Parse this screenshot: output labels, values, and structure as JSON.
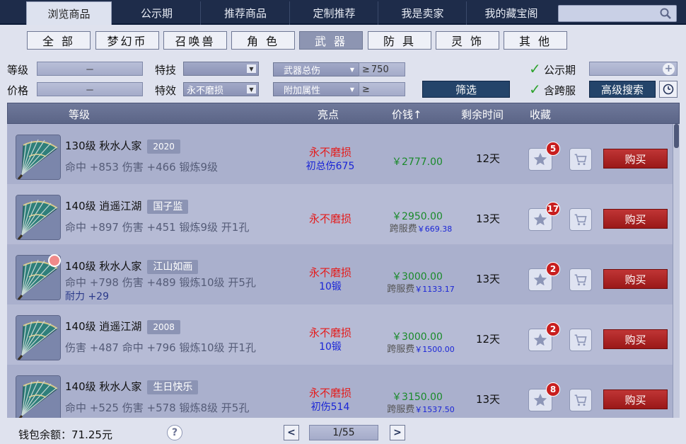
{
  "tabs": [
    {
      "label": "浏览商品",
      "active": true
    },
    {
      "label": "公示期",
      "active": false
    },
    {
      "label": "推荐商品",
      "active": false
    },
    {
      "label": "定制推荐",
      "active": false
    },
    {
      "label": "我是卖家",
      "active": false
    },
    {
      "label": "我的藏宝阁",
      "active": false
    }
  ],
  "search": {
    "value": ""
  },
  "categories": [
    {
      "label": "全 部",
      "active": false
    },
    {
      "label": "梦幻币",
      "active": false
    },
    {
      "label": "召唤兽",
      "active": false
    },
    {
      "label": "角 色",
      "active": false
    },
    {
      "label": "武 器",
      "active": true
    },
    {
      "label": "防 具",
      "active": false
    },
    {
      "label": "灵 饰",
      "active": false
    },
    {
      "label": "其 他",
      "active": false
    }
  ],
  "filters": {
    "level_label": "等级",
    "level_value": "－",
    "price_label": "价格",
    "price_value": "－",
    "skill_label": "特技",
    "skill_value": "",
    "effect_label": "特效",
    "effect_value": "永不磨损",
    "total_damage_select": "武器总伤",
    "total_damage_op": "≥",
    "total_damage_value": "750",
    "extra_attr_select": "附加属性",
    "extra_attr_op": "≥",
    "filter_button": "筛选",
    "public_period_label": "公示期",
    "public_period_checked": true,
    "cross_server_label": "含跨服",
    "cross_server_checked": true,
    "advanced_button": "高级搜索"
  },
  "table": {
    "headers": {
      "level": "等级",
      "highlights": "亮点",
      "price": "价钱",
      "price_sort": "↑",
      "remaining": "剩余时间",
      "favorite": "收藏"
    },
    "rows": [
      {
        "name": "130级  秋水人家",
        "tag": "2020",
        "stats": "命中 +853 伤害 +466 锻炼9级",
        "stats2": "",
        "highlight1": "永不磨损",
        "highlight2": "初总伤675",
        "price": "￥2777.00",
        "cross_fee_label": "",
        "cross_fee": "",
        "days": "12天",
        "fav_count": "5",
        "buy": "购买",
        "timer": false
      },
      {
        "name": "140级  逍遥江湖",
        "tag": "国子监",
        "stats": "命中 +897 伤害 +451 锻炼9级 开1孔",
        "stats2": "",
        "highlight1": "永不磨损",
        "highlight2": "",
        "price": "￥2950.00",
        "cross_fee_label": "跨服费",
        "cross_fee": "￥669.38",
        "days": "13天",
        "fav_count": "17",
        "buy": "购买",
        "timer": false
      },
      {
        "name": "140级  秋水人家",
        "tag": "江山如画",
        "stats": "命中 +798 伤害 +489 锻炼10级 开5孔",
        "stats2": "耐力 +29",
        "highlight1": "永不磨损",
        "highlight2": "10锻",
        "price": "￥3000.00",
        "cross_fee_label": "跨服费",
        "cross_fee": "￥1133.17",
        "days": "13天",
        "fav_count": "2",
        "buy": "购买",
        "timer": true
      },
      {
        "name": "140级  逍遥江湖",
        "tag": "2008",
        "stats": "伤害 +487 命中 +796 锻炼10级 开1孔",
        "stats2": "",
        "highlight1": "永不磨损",
        "highlight2": "10锻",
        "price": "￥3000.00",
        "cross_fee_label": "跨服费",
        "cross_fee": "￥1500.00",
        "days": "12天",
        "fav_count": "2",
        "buy": "购买",
        "timer": false
      },
      {
        "name": "140级  秋水人家",
        "tag": "生日快乐",
        "stats": "命中 +525 伤害 +578 锻炼8级 开5孔",
        "stats2": "",
        "highlight1": "永不磨损",
        "highlight2": "初伤514",
        "price": "￥3150.00",
        "cross_fee_label": "跨服费",
        "cross_fee": "￥1537.50",
        "days": "13天",
        "fav_count": "8",
        "buy": "购买",
        "timer": false
      }
    ]
  },
  "footer": {
    "wallet": "钱包余额：71.25元",
    "help": "?",
    "prev": "<",
    "next": ">",
    "page": "1/55"
  },
  "colors": {
    "topbar": "#1e2c4a",
    "highlight_red": "#e41b1b",
    "highlight_blue": "#1a25d6",
    "price_green": "#1a8a2a",
    "buy_red": "#b02626"
  },
  "icons": [
    "search-icon",
    "checkmark-icon",
    "plus-icon",
    "clock-icon",
    "fan-weapon-icon",
    "star-icon",
    "cart-icon",
    "help-icon"
  ]
}
